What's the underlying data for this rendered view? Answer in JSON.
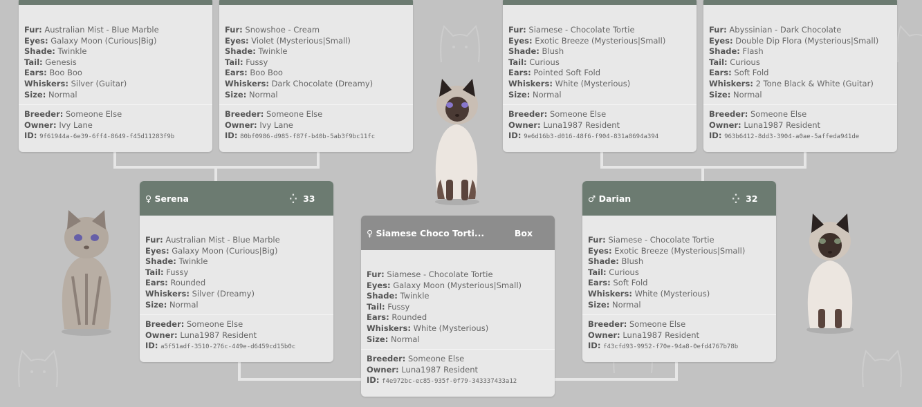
{
  "labels": {
    "fur": "Fur:",
    "eyes": "Eyes:",
    "shade": "Shade:",
    "tail": "Tail:",
    "ears": "Ears:",
    "whiskers": "Whiskers:",
    "size": "Size:",
    "breeder": "Breeder:",
    "owner": "Owner:",
    "id": "ID:"
  },
  "grandparents": [
    {
      "fur": "Australian Mist - Blue Marble",
      "eyes": "Galaxy Moon (Curious|Big)",
      "shade": "Twinkle",
      "tail": "Genesis",
      "ears": "Boo Boo",
      "whiskers": "Silver (Guitar)",
      "size": "Normal",
      "breeder": "Someone Else",
      "owner": "Ivy Lane",
      "id": "9f61944a-6e39-6ff4-8649-f45d11283f9b"
    },
    {
      "fur": "Snowshoe - Cream",
      "eyes": "Violet (Mysterious|Small)",
      "shade": "Twinkle",
      "tail": "Fussy",
      "ears": "Boo Boo",
      "whiskers": "Dark Chocolate (Dreamy)",
      "size": "Normal",
      "breeder": "Someone Else",
      "owner": "Ivy Lane",
      "id": "80bf0986-d985-f87f-b40b-5ab3f9bc11fc"
    },
    {
      "fur": "Siamese - Chocolate Tortie",
      "eyes": "Exotic Breeze (Mysterious|Small)",
      "shade": "Blush",
      "tail": "Curious",
      "ears": "Pointed Soft Fold",
      "whiskers": "White (Mysterious)",
      "size": "Normal",
      "breeder": "Someone Else",
      "owner": "Luna1987 Resident",
      "id": "9e6d16b3-d016-48f6-f904-831a8694a394"
    },
    {
      "fur": "Abyssinian - Dark Chocolate",
      "eyes": "Double Dip Flora (Mysterious|Small)",
      "shade": "Flash",
      "tail": "Curious",
      "ears": "Soft Fold",
      "whiskers": "2 Tone Black & White (Guitar)",
      "size": "Normal",
      "breeder": "Someone Else",
      "owner": "Luna1987 Resident",
      "id": "963b6412-8dd3-3904-a0ae-5affeda941de"
    }
  ],
  "mother": {
    "gender_icon": "♀",
    "name": "Serena",
    "age_icon": "loading-icon",
    "age": "33",
    "fur": "Australian Mist - Blue Marble",
    "eyes": "Galaxy Moon (Curious|Big)",
    "shade": "Twinkle",
    "tail": "Fussy",
    "ears": "Rounded",
    "whiskers": "Silver (Dreamy)",
    "size": "Normal",
    "breeder": "Someone Else",
    "owner": "Luna1987 Resident",
    "id": "a5f51adf-3510-276c-449e-d6459cd15b0c"
  },
  "father": {
    "gender_icon": "♂",
    "name": "Darian",
    "age_icon": "loading-icon",
    "age": "32",
    "fur": "Siamese - Chocolate Tortie",
    "eyes": "Exotic Breeze (Mysterious|Small)",
    "shade": "Blush",
    "tail": "Curious",
    "ears": "Soft Fold",
    "whiskers": "White (Mysterious)",
    "size": "Normal",
    "breeder": "Someone Else",
    "owner": "Luna1987 Resident",
    "id": "f43cfd93-9952-f70e-94a8-0efd4767b78b"
  },
  "child": {
    "gender_icon": "♀",
    "name": "Siamese Choco Torti...",
    "status": "Box",
    "fur": "Siamese - Chocolate Tortie",
    "eyes": "Galaxy Moon (Mysterious|Small)",
    "shade": "Twinkle",
    "tail": "Fussy",
    "ears": "Rounded",
    "whiskers": "White (Mysterious)",
    "size": "Normal",
    "breeder": "Someone Else",
    "owner": "Luna1987 Resident",
    "id": "f4e972bc-ec85-935f-0f79-343337433a12"
  },
  "colors": {
    "header_green": "#6c7b71",
    "header_gray": "#8d8d8d",
    "card_bg": "#e8e8e8",
    "page_bg": "#c2c2c2"
  }
}
